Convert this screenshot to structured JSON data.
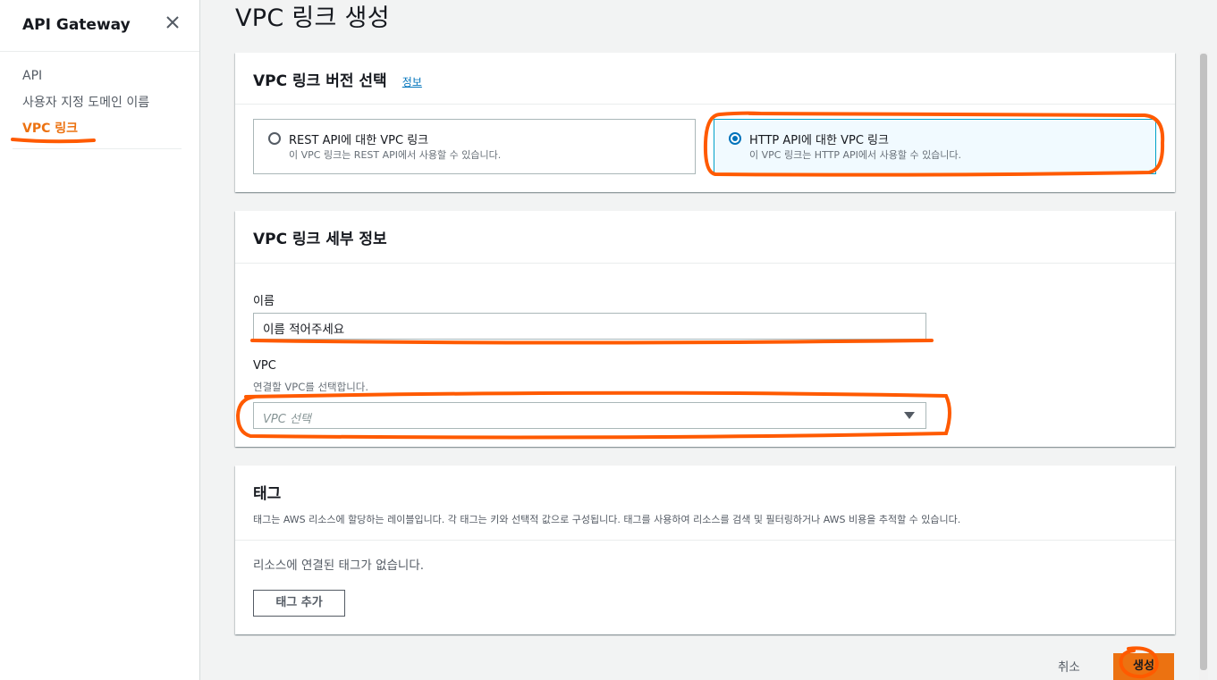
{
  "sidebar": {
    "title": "API Gateway",
    "items": [
      {
        "label": "API"
      },
      {
        "label": "사용자 지정 도메인 이름"
      },
      {
        "label": "VPC 링크"
      }
    ]
  },
  "page": {
    "title": "VPC 링크 생성"
  },
  "version_panel": {
    "title": "VPC 링크 버전 선택",
    "info_link": "정보",
    "options": [
      {
        "label": "REST API에 대한 VPC 링크",
        "desc": "이 VPC 링크는 REST API에서 사용할 수 있습니다.",
        "selected": false
      },
      {
        "label": "HTTP API에 대한 VPC 링크",
        "desc": "이 VPC 링크는 HTTP API에서 사용할 수 있습니다.",
        "selected": true
      }
    ]
  },
  "details_panel": {
    "title": "VPC 링크 세부 정보",
    "name_label": "이름",
    "name_value": "이름 적어주세요",
    "vpc_label": "VPC",
    "vpc_desc": "연결할 VPC를 선택합니다.",
    "vpc_placeholder": "VPC 선택"
  },
  "tags_panel": {
    "title": "태그",
    "desc": "태그는 AWS 리소스에 할당하는 레이블입니다. 각 태그는 키와 선택적 값으로 구성됩니다. 태그를 사용하여 리소스를 검색 및 필터링하거나 AWS 비용을 추적할 수 있습니다.",
    "empty": "리소스에 연결된 태그가 없습니다.",
    "add_button": "태그 추가"
  },
  "footer": {
    "cancel": "취소",
    "create": "생성"
  },
  "colors": {
    "accent": "#ec7211",
    "link": "#0073bb",
    "annotation": "#ff5a00"
  }
}
